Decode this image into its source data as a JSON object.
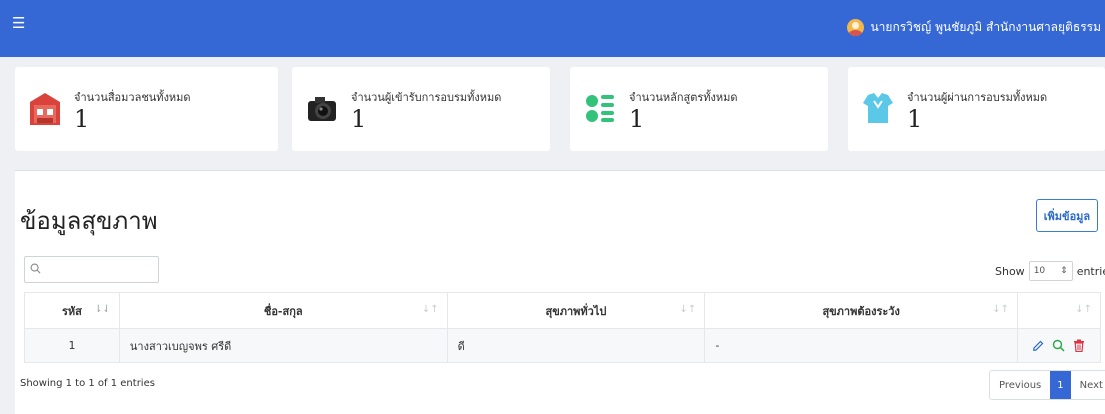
{
  "topbar": {
    "menu_icon": "hamburger-icon",
    "user_label": "นายกรวิชญ์ พูนชัยภูมิ สำนักงานศาลยุติธรรม"
  },
  "cards": [
    {
      "label": "จำนวนสื่อมวลชนทั้งหมด",
      "value": "1",
      "icon": "building-icon",
      "color": "#d9433b"
    },
    {
      "label": "จำนวนผู้เข้ารับการอบรมทั้งหมด",
      "value": "1",
      "icon": "camera-icon",
      "color": "#222222"
    },
    {
      "label": "จำนวนหลักสูตรทั้งหมด",
      "value": "1",
      "icon": "list-icon",
      "color": "#33c27a"
    },
    {
      "label": "จำนวนผู้ผ่านการอบรมทั้งหมด",
      "value": "1",
      "icon": "shirt-icon",
      "color": "#5bc8e8"
    }
  ],
  "panel": {
    "title": "ข้อมูลสุขภาพ",
    "add_button": "เพิ่มข้อมูล",
    "search_placeholder": "",
    "show_label": "Show",
    "page_size": "10",
    "entries_label": "entries"
  },
  "table": {
    "columns": [
      "รหัส",
      "ชื่อ-สกุล",
      "สุขภาพทั่วไป",
      "สุขภาพต้องระวัง",
      ""
    ],
    "rows": [
      {
        "id": "1",
        "name": "นางสาวเบญจพร ศรีดี",
        "general": "ดี",
        "caution": "-"
      }
    ]
  },
  "footer": {
    "info": "Showing 1 to 1 of 1 entries",
    "previous": "Previous",
    "page": "1",
    "next": "Next"
  },
  "colors": {
    "accent": "#3568d4",
    "edit": "#2b6ac9",
    "view": "#28a745",
    "delete": "#dc3545"
  }
}
